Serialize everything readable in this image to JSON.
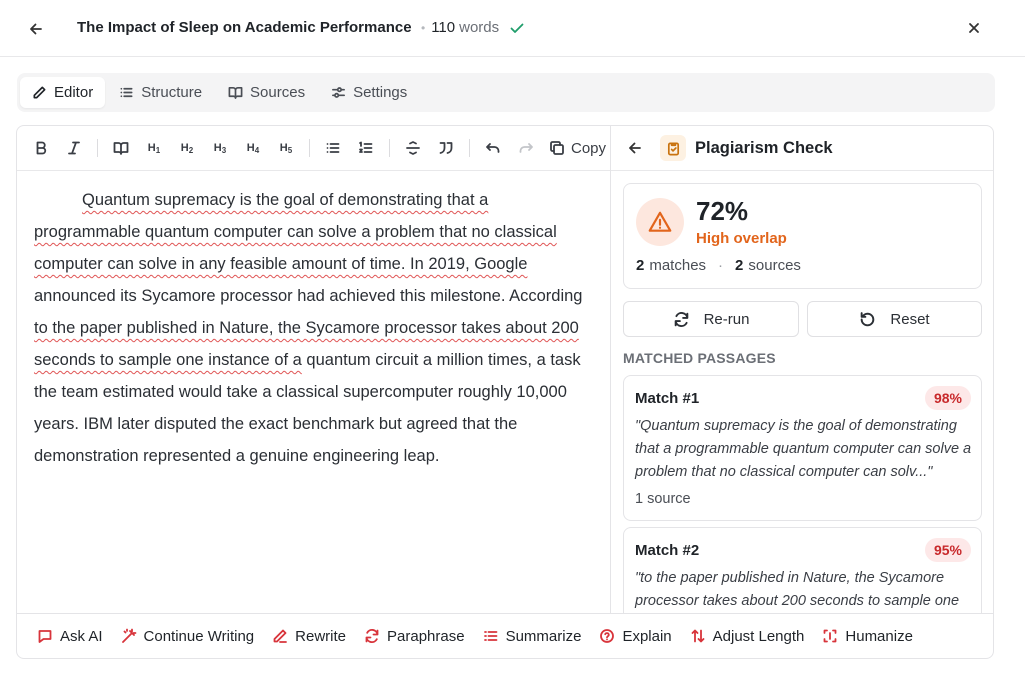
{
  "header": {
    "title": "The Impact of Sleep on Academic Performance",
    "word_count": "110",
    "word_label": "words"
  },
  "tabs": [
    {
      "label": "Editor",
      "icon": "pencil-icon",
      "active": true
    },
    {
      "label": "Structure",
      "icon": "list-icon",
      "active": false
    },
    {
      "label": "Sources",
      "icon": "book-icon",
      "active": false
    },
    {
      "label": "Settings",
      "icon": "sliders-icon",
      "active": false
    }
  ],
  "toolbar": {
    "bold": "B",
    "italic": "I",
    "h1": "H",
    "h2": "H",
    "h3": "H",
    "h4": "H",
    "h5": "H",
    "h1_n": "1",
    "h2_n": "2",
    "h3_n": "3",
    "h4_n": "4",
    "h5_n": "5",
    "copy_label": "Copy"
  },
  "document": {
    "seg1": "Quantum supremacy is the goal of demonstrating that a programmable quantum computer can solve a problem that no classical computer can solve in any feasible amount of time. In 2019, Google",
    "seg2": " announced its Sycamore processor had achieved this milestone. According ",
    "seg3": "to the paper published in Nature, the Sycamore processor takes about 200 seconds to sample one instance of a",
    "seg4": " quantum circuit a million times, a task the team estimated would take a classical supercomputer roughly 10,000 years. IBM later disputed the exact benchmark but agreed that the demonstration represented a genuine engineering leap."
  },
  "plagiarism": {
    "title": "Plagiarism Check",
    "score": "72%",
    "score_label": "High overlap",
    "matches_count": "2",
    "matches_label": "matches",
    "sources_count": "2",
    "sources_label": "sources",
    "rerun_label": "Re-run",
    "reset_label": "Reset",
    "section_label": "MATCHED PASSAGES",
    "matches": [
      {
        "title": "Match #1",
        "percent": "98%",
        "quote": "\"Quantum supremacy is the goal of demonstrating that a programmable quantum computer can solve a problem that no classical computer can solv...\"",
        "sources": "1 source"
      },
      {
        "title": "Match #2",
        "percent": "95%",
        "quote": "\"to the paper published in Nature, the Sycamore processor takes about 200 seconds to sample one",
        "sources": ""
      }
    ]
  },
  "actions": [
    {
      "label": "Ask AI",
      "icon": "chat-icon"
    },
    {
      "label": "Continue Writing",
      "icon": "magic-wand-icon"
    },
    {
      "label": "Rewrite",
      "icon": "pen-icon"
    },
    {
      "label": "Paraphrase",
      "icon": "refresh-icon"
    },
    {
      "label": "Summarize",
      "icon": "list-lines-icon"
    },
    {
      "label": "Explain",
      "icon": "help-circle-icon"
    },
    {
      "label": "Adjust Length",
      "icon": "arrows-vertical-icon"
    },
    {
      "label": "Humanize",
      "icon": "scan-icon"
    }
  ],
  "colors": {
    "accent_red": "#d8343b",
    "warning_orange": "#e2651c",
    "success_green": "#1f9d6b",
    "badge_red_bg": "#fde8e8"
  }
}
